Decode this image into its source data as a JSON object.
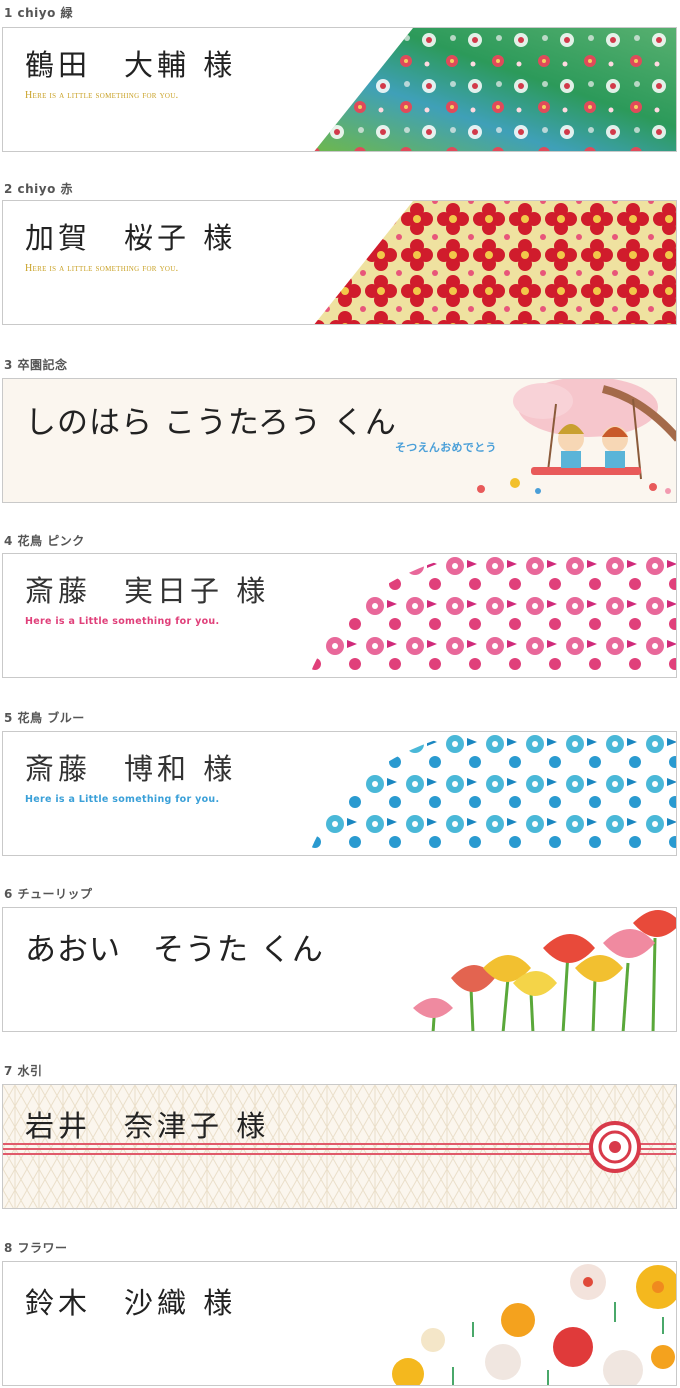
{
  "cards": [
    {
      "label": "1 chiyo 緑",
      "name": "鶴田　大輔 様",
      "message": "Here is a little something for you.",
      "message_color": "#c9a227",
      "accent": "#2f9d6a"
    },
    {
      "label": "2 chiyo 赤",
      "name": "加賀　桜子 様",
      "message": "Here is a little something for you.",
      "message_color": "#c9a227",
      "accent": "#c8102e"
    },
    {
      "label": "3 卒園記念",
      "name": "しのはら こうたろう くん",
      "message": "そつえんおめでとう",
      "message_color": "#4a9fd8",
      "accent": "#f4b8c0"
    },
    {
      "label": "4 花鳥 ピンク",
      "name": "斎藤　実日子 様",
      "message": "Here is a Little something for you.",
      "message_color": "#e0407a",
      "accent": "#e0407a"
    },
    {
      "label": "5 花鳥 ブルー",
      "name": "斎藤　博和 様",
      "message": "Here is a Little something for you.",
      "message_color": "#3aa0d8",
      "accent": "#3aa8d4"
    },
    {
      "label": "6 チューリップ",
      "name": "あおい　そうた くん",
      "message": "",
      "accent": "#e35a4a"
    },
    {
      "label": "7 水引",
      "name": "岩井　奈津子 様",
      "message": "",
      "accent": "#d83a4a"
    },
    {
      "label": "8 フラワー",
      "name": "鈴木　沙織 様",
      "message": "",
      "accent": "#f2a61e"
    }
  ]
}
